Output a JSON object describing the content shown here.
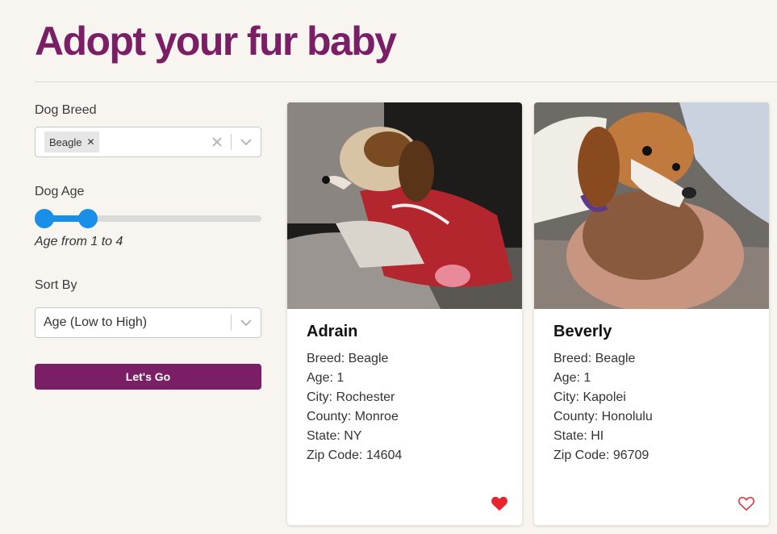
{
  "page": {
    "title": "Adopt your fur baby"
  },
  "filters": {
    "breed_label": "Dog Breed",
    "breed_selected": "Beagle",
    "age_label": "Dog Age",
    "age_range": {
      "min": 1,
      "max": 4
    },
    "age_caption": "Age from 1 to 4",
    "sort_label": "Sort By",
    "sort_value": "Age (Low to High)",
    "go_label": "Let's Go"
  },
  "colors": {
    "brand": "#7a1f66",
    "slider": "#1a8fe8",
    "heart": "#e8242e"
  },
  "dogs": [
    {
      "name": "Adrain",
      "breed": "Breed: Beagle",
      "age": "Age: 1",
      "city": "City: Rochester",
      "county": "County: Monroe",
      "state": "State: NY",
      "zip": "Zip Code: 14604",
      "favorited": true
    },
    {
      "name": "Beverly",
      "breed": "Breed: Beagle",
      "age": "Age: 1",
      "city": "City: Kapolei",
      "county": "County: Honolulu",
      "state": "State: HI",
      "zip": "Zip Code: 96709",
      "favorited": false
    }
  ]
}
